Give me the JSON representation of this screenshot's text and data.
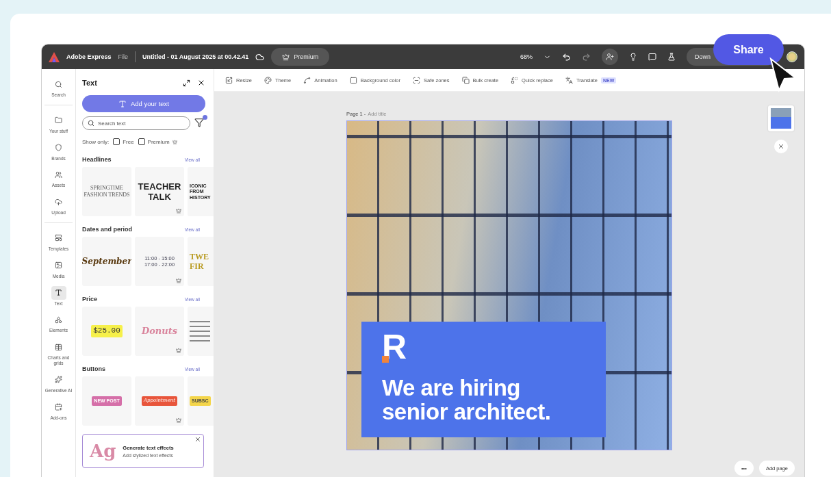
{
  "app_bar": {
    "app_name": "Adobe Express",
    "menu": "File",
    "document_title": "Untitled - 01 August 2025 at 00.42.41",
    "premium_button": "Premium",
    "zoom": "68%",
    "download_button": "Down"
  },
  "share_button": "Share",
  "toolbar": [
    {
      "label": "Resize"
    },
    {
      "label": "Theme"
    },
    {
      "label": "Animation"
    },
    {
      "label": "Background color"
    },
    {
      "label": "Safe zones"
    },
    {
      "label": "Bulk create"
    },
    {
      "label": "Quick replace"
    },
    {
      "label": "Translate",
      "badge": "NEW"
    }
  ],
  "rail_groups": [
    [
      {
        "label": "Search",
        "selected": false
      }
    ],
    [
      {
        "label": "Your stuff",
        "selected": false
      },
      {
        "label": "Brands",
        "selected": false
      },
      {
        "label": "Assets",
        "selected": false
      },
      {
        "label": "Upload",
        "selected": false
      }
    ],
    [
      {
        "label": "Templates",
        "selected": false
      },
      {
        "label": "Media",
        "selected": false
      },
      {
        "label": "Text",
        "selected": true
      },
      {
        "label": "Elements",
        "selected": false
      },
      {
        "label": "Charts and grids",
        "selected": false
      },
      {
        "label": "Generative AI",
        "selected": false
      },
      {
        "label": "Add-ons",
        "selected": false
      }
    ]
  ],
  "panel": {
    "title": "Text",
    "add_button": "Add your text",
    "search_placeholder": "Search text",
    "show_only_label": "Show only:",
    "filters": [
      {
        "label": "Free",
        "checked": false,
        "premium": false
      },
      {
        "label": "Premium",
        "checked": false,
        "premium": true
      }
    ],
    "sections": [
      {
        "title": "Headlines",
        "link": "View all",
        "items": [
          {
            "kind": "serif",
            "lines": [
              "SPRINGTIME",
              "FASHION TRENDS"
            ],
            "premium": false
          },
          {
            "kind": "poster",
            "lines": [
              "TEACHER",
              "TALK"
            ],
            "premium": true
          },
          {
            "kind": "stacked",
            "lines": [
              "ICONIC",
              "FROM",
              "HISTORY"
            ],
            "premium": false
          }
        ]
      },
      {
        "title": "Dates and period",
        "link": "View all",
        "items": [
          {
            "kind": "script",
            "lines": [
              "September"
            ],
            "premium": false
          },
          {
            "kind": "timetable",
            "lines": [
              "11:00 - 15:00",
              "17:00 - 22:00"
            ],
            "premium": true
          },
          {
            "kind": "tall",
            "lines": [
              "TWE",
              "FIR"
            ],
            "premium": false
          }
        ]
      },
      {
        "title": "Price",
        "link": "View all",
        "items": [
          {
            "kind": "price",
            "lines": [
              "$25.00"
            ],
            "premium": false
          },
          {
            "kind": "bubbly",
            "lines": [
              "Donuts"
            ],
            "premium": true
          },
          {
            "kind": "list",
            "premium": false
          }
        ]
      },
      {
        "title": "Buttons",
        "link": "View all",
        "items": [
          {
            "kind": "pill",
            "lines": [
              "NEW POST"
            ],
            "premium": false
          },
          {
            "kind": "banner",
            "lines": [
              "Appointment"
            ],
            "premium": true
          },
          {
            "kind": "yellow",
            "lines": [
              "SUBSC"
            ],
            "premium": false
          }
        ]
      }
    ],
    "promo": {
      "art": "Ag",
      "title": "Generate text effects",
      "subtitle": "Add stylized text effects"
    }
  },
  "canvas": {
    "page_label": "Page 1 -",
    "title_placeholder": "Add title",
    "design": {
      "logo": "R",
      "headline": [
        "We are hiring",
        "senior architect."
      ]
    },
    "more_button": "•••",
    "add_page_button": "Add page"
  }
}
